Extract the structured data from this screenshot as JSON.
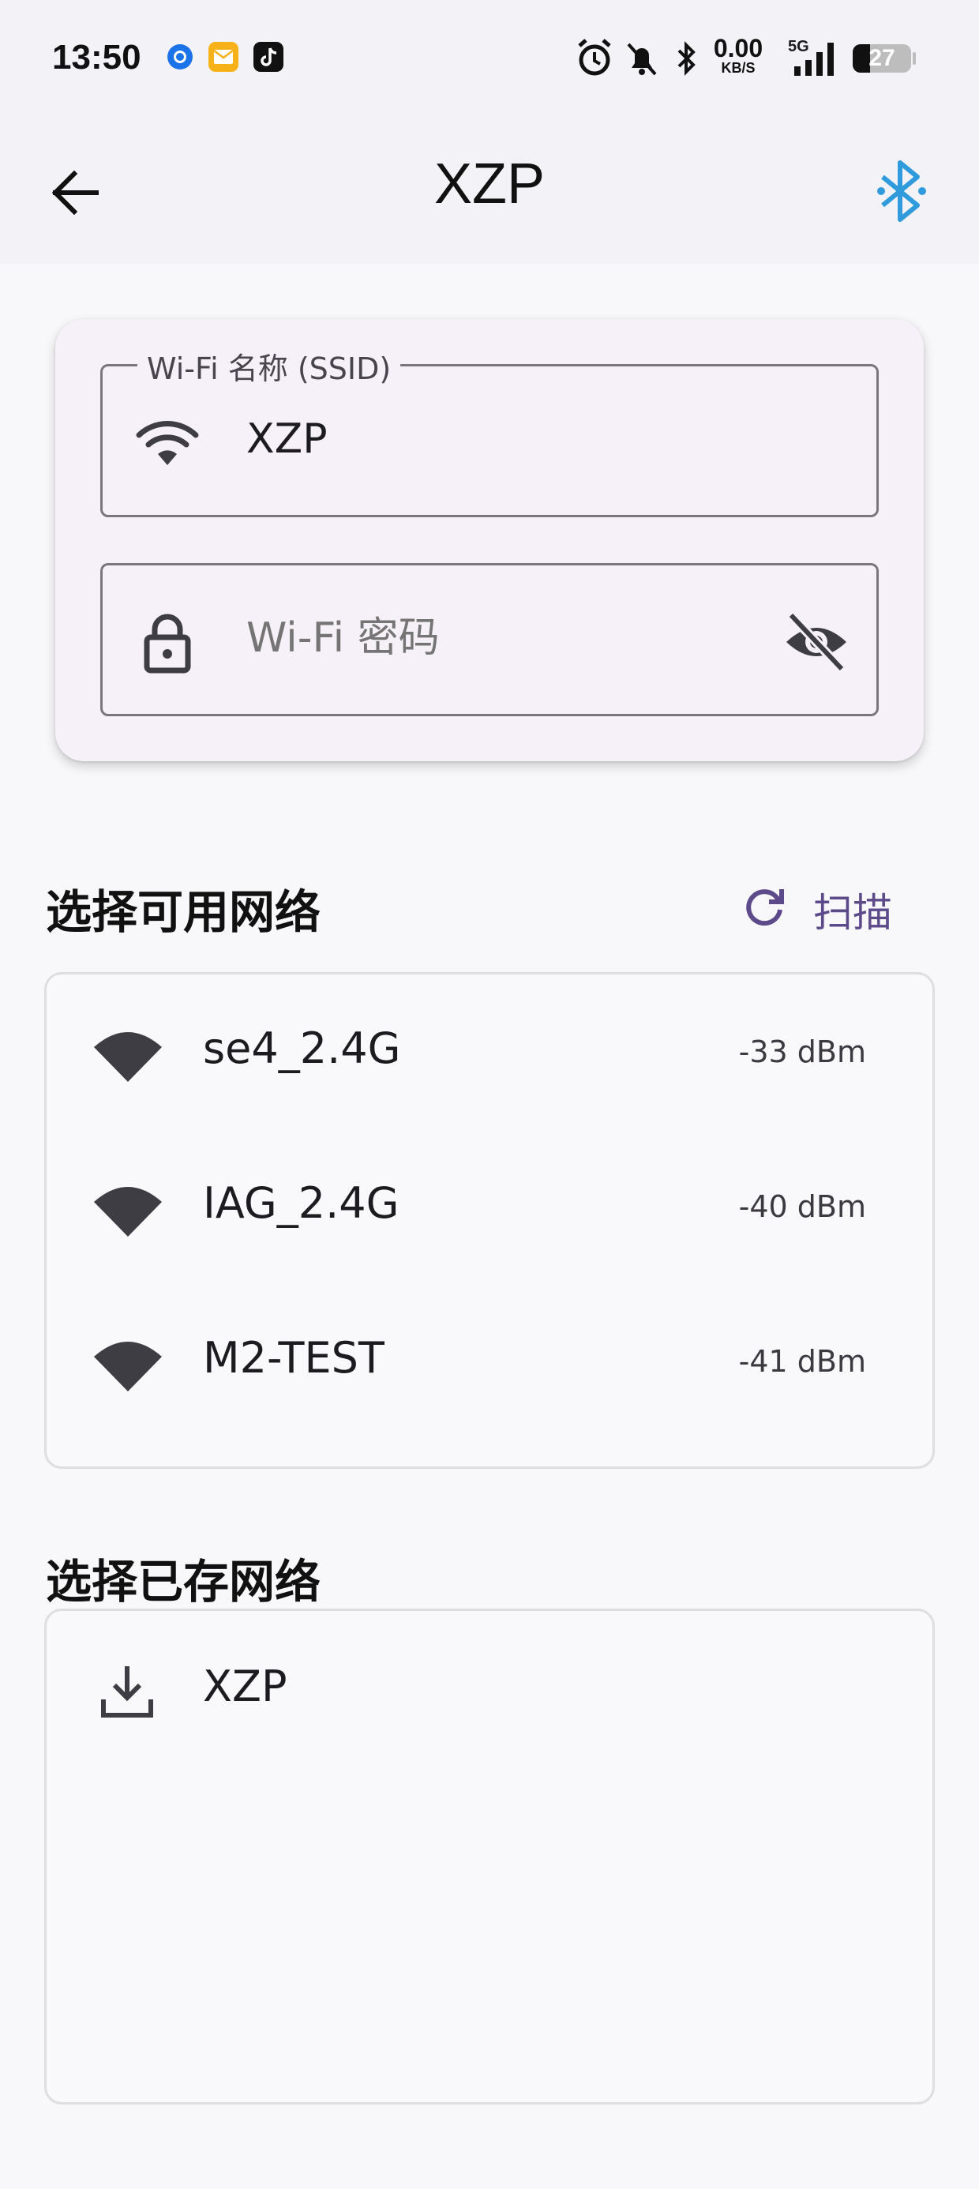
{
  "status_bar": {
    "time": "13:50",
    "network_speed_value": "0.00",
    "network_speed_unit": "KB/S",
    "network_type": "5G",
    "battery_level": "27",
    "app_icons": [
      "chrome-icon",
      "mail-icon",
      "tiktok-icon"
    ],
    "status_icons": [
      "alarm-icon",
      "bell-off-icon",
      "bluetooth-icon",
      "signal-icon",
      "battery-icon"
    ]
  },
  "app_bar": {
    "title": "XZP",
    "accent_color": "#2f9bdc"
  },
  "credentials": {
    "ssid_label": "Wi-Fi 名称 (SSID)",
    "ssid_value": "XZP",
    "password_placeholder": "Wi-Fi 密码",
    "password_value": ""
  },
  "available": {
    "title": "选择可用网络",
    "scan_label": "扫描",
    "scan_color": "#5c4a8a",
    "networks": [
      {
        "name": "se4_2.4G",
        "signal": "-33 dBm"
      },
      {
        "name": "IAG_2.4G",
        "signal": "-40 dBm"
      },
      {
        "name": "M2-TEST",
        "signal": "-41 dBm"
      }
    ]
  },
  "saved": {
    "title": "选择已存网络",
    "networks": [
      {
        "name": "XZP"
      }
    ]
  }
}
